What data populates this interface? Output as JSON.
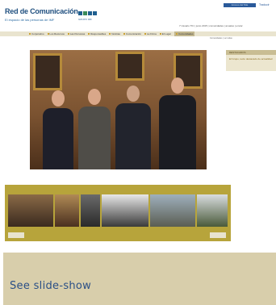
{
  "header": {
    "logo_title": "Red de Comunicación",
    "logo_tagline": "El espacio de las personas de IMF",
    "logo_sub": "GRUPO IMF",
    "top_link_box": "Acceso del Site",
    "top_link_2": "Traducir",
    "info_line": "7 Usuario TIC | junio 2015 | comunidades | anuales | enviar"
  },
  "nav": {
    "items": [
      "Corporativo",
      "Los Recursos",
      "Las Personas",
      "Responsables",
      "Noticias",
      "Comunicación",
      "La Firma",
      "El Lugar",
      "Comunidades"
    ],
    "active_index": 8,
    "subnav": "Comunidades | ver todas"
  },
  "sidebar": {
    "heading": "DESTACADOS",
    "text": "El Grupo, texto destacado de actualidad"
  },
  "colors": {
    "accent_blue": "#2a4f86",
    "strip_gold": "#b7a43b",
    "panel_beige": "#d8ceab",
    "nav_beige": "#e9e4cf"
  },
  "slideshow": {
    "label": "See slide-show"
  }
}
